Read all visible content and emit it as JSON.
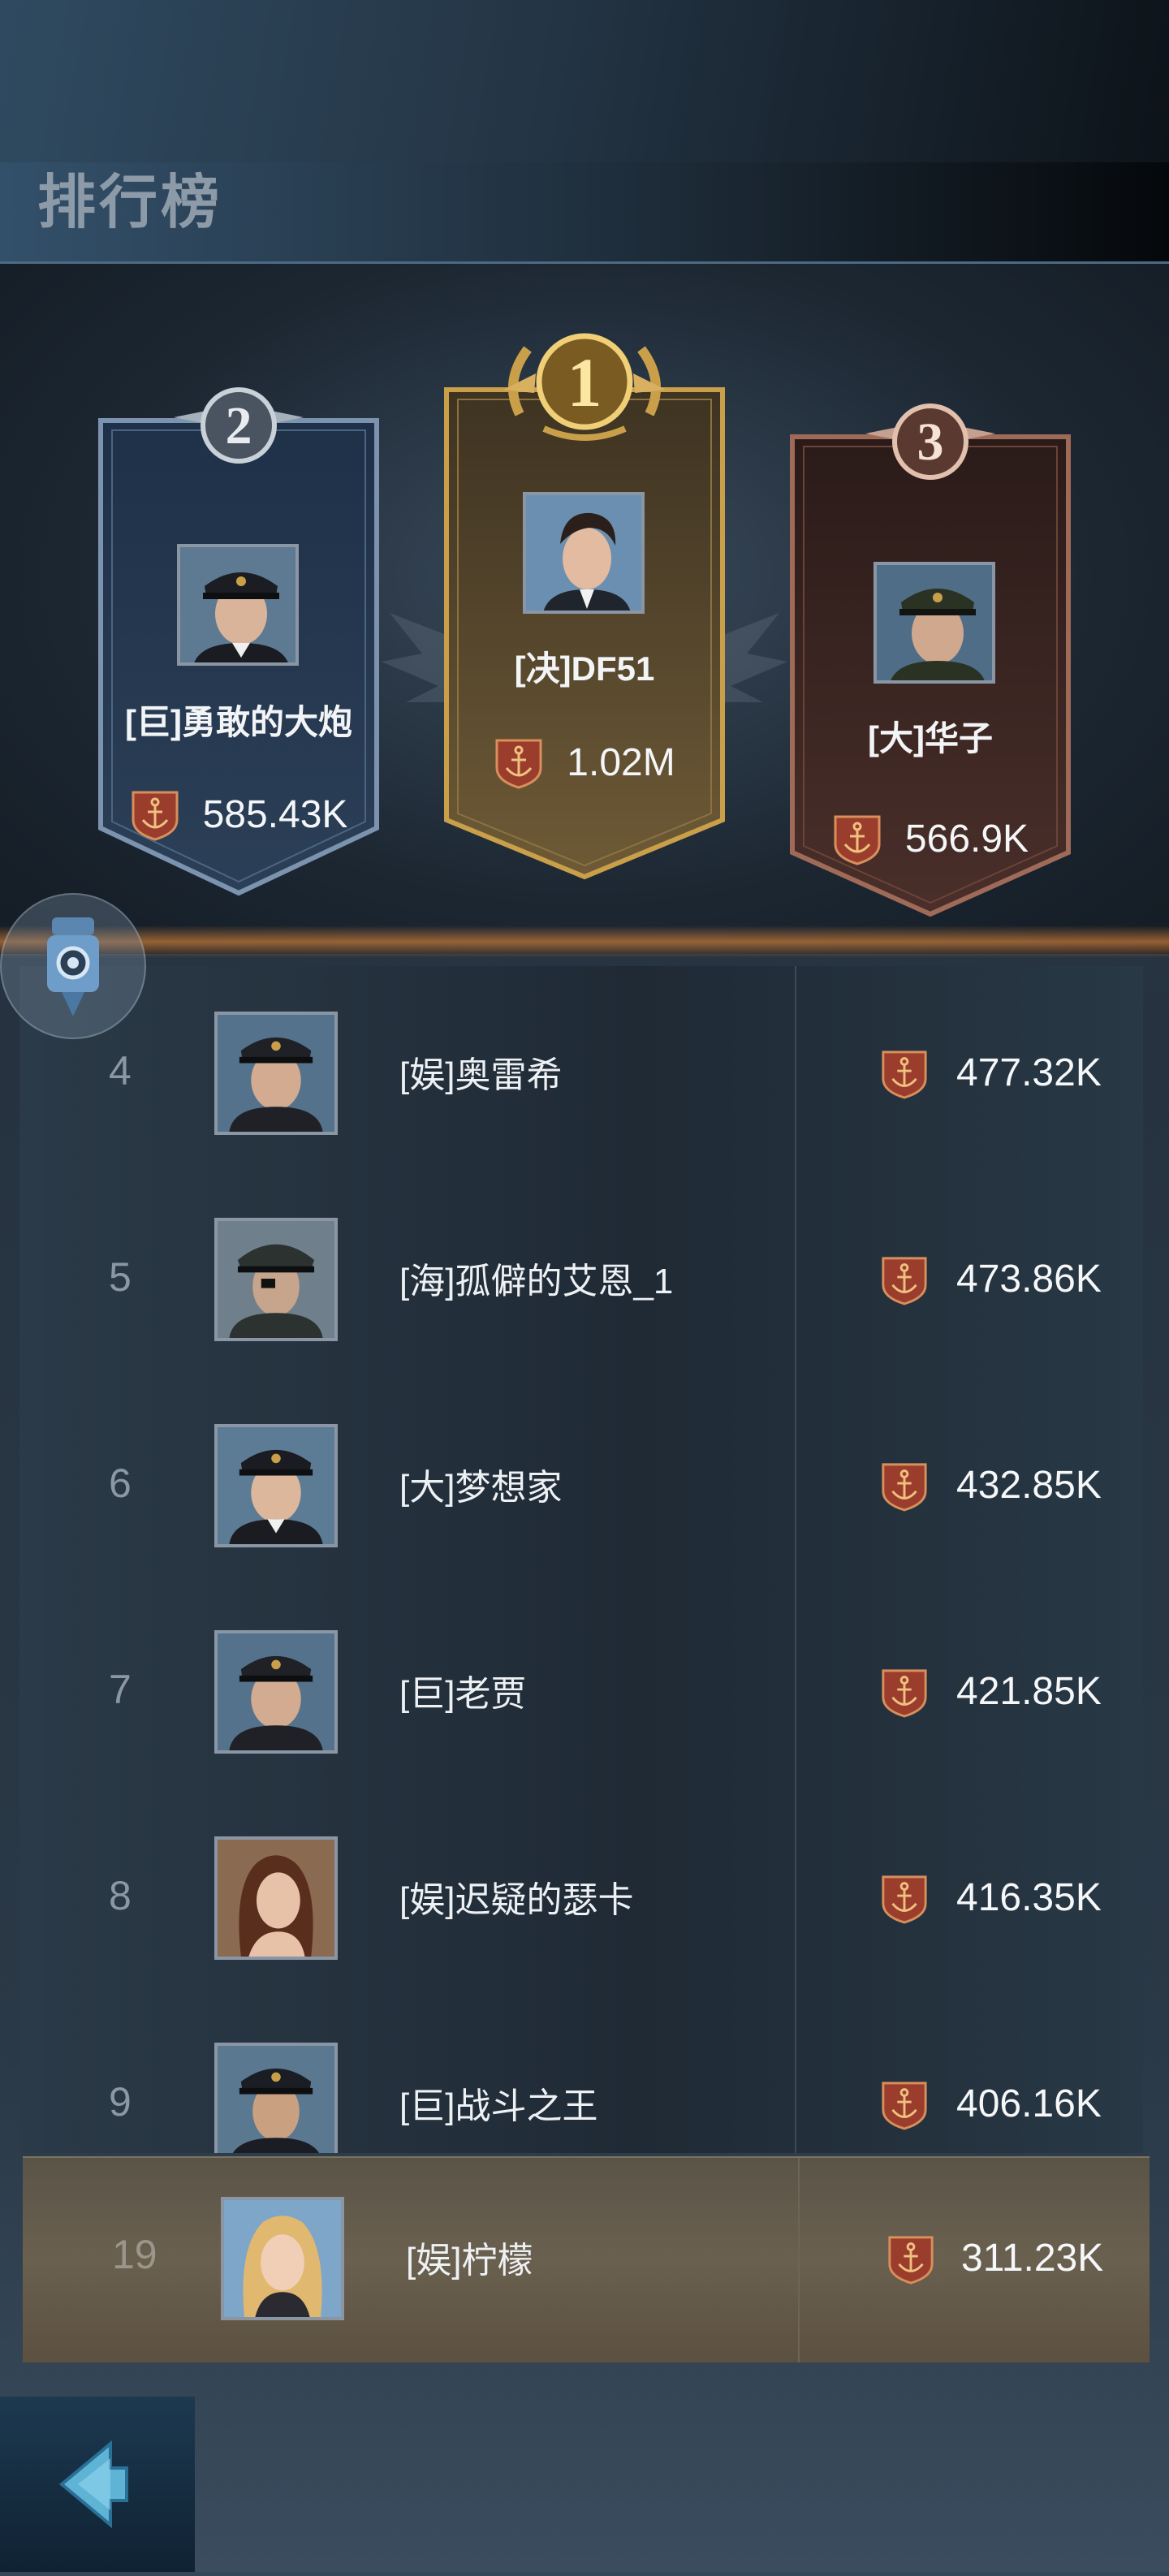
{
  "header": {
    "title": "排行榜"
  },
  "podium": [
    {
      "rank": 2,
      "name": "[巨]勇敢的大炮",
      "score": "585.43K",
      "rank_label": "2"
    },
    {
      "rank": 1,
      "name": "[决]DF51",
      "score": "1.02M",
      "rank_label": "1"
    },
    {
      "rank": 3,
      "name": "[大]华子",
      "score": "566.9K",
      "rank_label": "3"
    }
  ],
  "rows": [
    {
      "rank": "4",
      "name": "[娱]奥雷希",
      "score": "477.32K",
      "avatar": "officer-elderly"
    },
    {
      "rank": "5",
      "name": "[海]孤僻的艾恩_1",
      "score": "473.86K",
      "avatar": "officer-eyepatch"
    },
    {
      "rank": "6",
      "name": "[大]梦想家",
      "score": "432.85K",
      "avatar": "officer-gray"
    },
    {
      "rank": "7",
      "name": "[巨]老贾",
      "score": "421.85K",
      "avatar": "officer-elderly"
    },
    {
      "rank": "8",
      "name": "[娱]迟疑的瑟卡",
      "score": "416.35K",
      "avatar": "woman-brunette"
    },
    {
      "rank": "9",
      "name": "[巨]战斗之王",
      "score": "406.16K",
      "avatar": "officer-young"
    }
  ],
  "self": {
    "rank": "19",
    "name": "[娱]柠檬",
    "score": "311.23K",
    "avatar": "woman-blonde"
  },
  "icons": {
    "score": "anchor-shield-icon",
    "back": "back-arrow-icon",
    "float": "camera-drone-icon"
  },
  "colors": {
    "gold": "#c9a049",
    "silver": "#7c93b0",
    "bronze": "#a06a58",
    "anchor_shield": "#9a3d2c",
    "anchor_stroke": "#e0a070"
  }
}
